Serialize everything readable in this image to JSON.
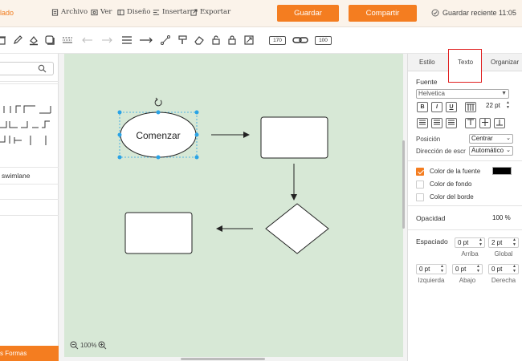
{
  "header": {
    "doc_title": "lado",
    "menu": [
      {
        "label": "Archivo",
        "icon": "file-icon"
      },
      {
        "label": "Ver",
        "icon": "view-icon"
      },
      {
        "label": "Diseño",
        "icon": "layout-icon"
      },
      {
        "label": "Insertar",
        "icon": "insert-icon"
      },
      {
        "label": "Exportar",
        "icon": "export-icon"
      }
    ],
    "save_label": "Guardar",
    "share_label": "Compartir",
    "saved_status": "Guardar reciente 11:05",
    "accent_color": "#f47d20"
  },
  "toolbar": {
    "width_value": "170",
    "height_value": "100"
  },
  "left_panel": {
    "search_placeholder": "",
    "swimlane_label": "swimlane",
    "more_shapes_label": "s Formas"
  },
  "canvas": {
    "start_label": "Comenzar",
    "background_color": "#d7e8d6",
    "zoom_level": "100%"
  },
  "right_panel": {
    "tabs": [
      "Estilo",
      "Texto",
      "Organizar"
    ],
    "active_tab": "Texto",
    "font_section": "Fuente",
    "font_family": "Helvetica",
    "font_size": "22 pt",
    "format_buttons": [
      "B",
      "I",
      "U"
    ],
    "position_label": "Posición",
    "position_value": "Centrar",
    "direction_label": "Dirección de escr",
    "direction_value": "Automático",
    "font_color_label": "Color de la fuente",
    "font_color_value": "#000000",
    "bg_color_label": "Color de fondo",
    "border_color_label": "Color del borde",
    "opacity_label": "Opacidad",
    "opacity_value": "100 %",
    "spacing_label": "Espaciado",
    "spacing_top_value": "0 pt",
    "spacing_top_label": "Arriba",
    "spacing_global_value": "2 pt",
    "spacing_global_label": "Global",
    "spacing_left_value": "0 pt",
    "spacing_left_label": "Izquierda",
    "spacing_bottom_value": "0 pt",
    "spacing_bottom_label": "Abajo",
    "spacing_right_value": "0 pt",
    "spacing_right_label": "Derecha"
  }
}
